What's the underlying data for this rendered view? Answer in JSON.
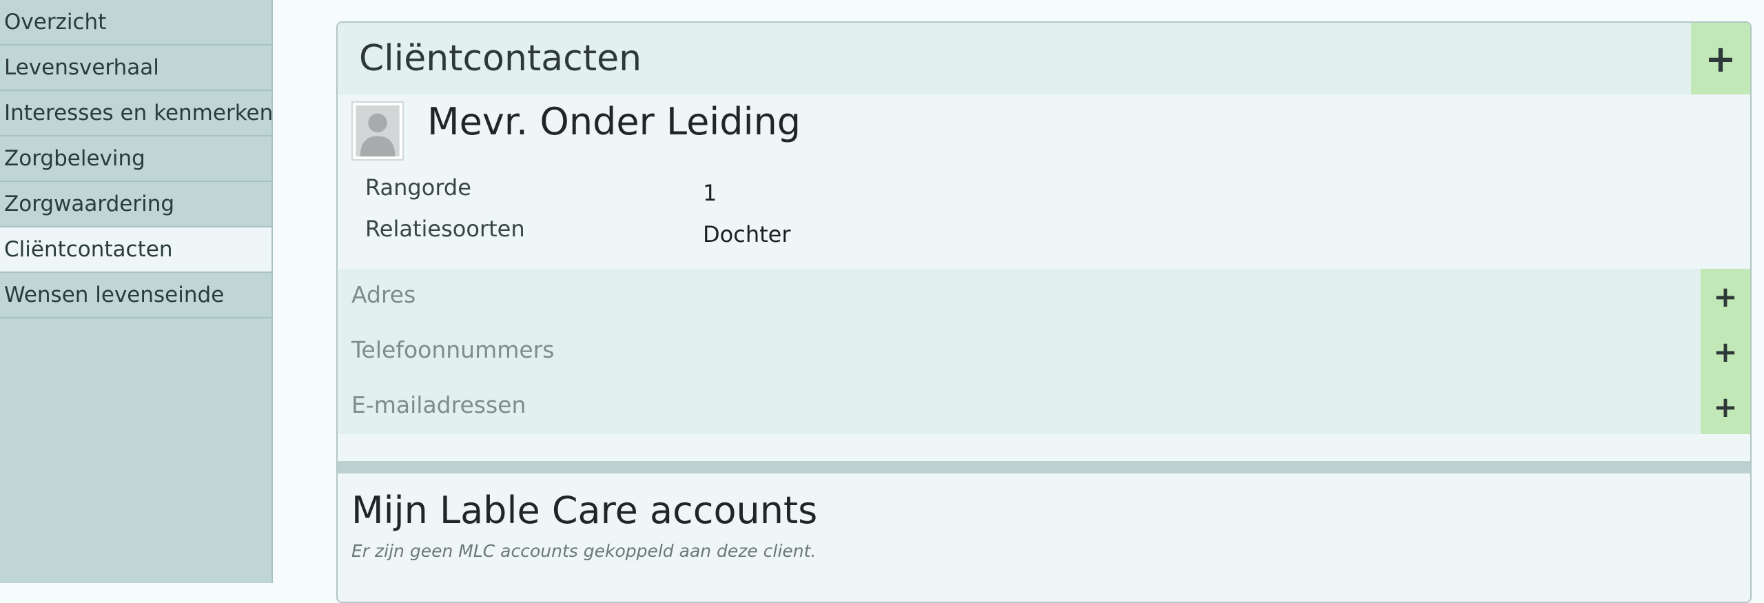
{
  "sidebar": {
    "items": [
      {
        "label": "Overzicht"
      },
      {
        "label": "Levensverhaal"
      },
      {
        "label": "Interesses en kenmerken"
      },
      {
        "label": "Zorgbeleving"
      },
      {
        "label": "Zorgwaardering"
      },
      {
        "label": "Cliëntcontacten",
        "active": true
      },
      {
        "label": "Wensen levenseinde"
      }
    ]
  },
  "panel": {
    "title": "Cliëntcontacten",
    "add_icon": "plus-icon",
    "contact": {
      "name": "Mevr. Onder Leiding",
      "avatar_icon": "user-silhouette-icon",
      "fields": [
        {
          "label": "Rangorde",
          "value": "1"
        },
        {
          "label": "Relatiesoorten",
          "value": "Dochter"
        }
      ]
    },
    "sub_sections": [
      {
        "label": "Adres"
      },
      {
        "label": "Telefoonnummers"
      },
      {
        "label": "E-mailadressen"
      }
    ]
  },
  "mlc": {
    "title": "Mijn Lable Care accounts",
    "note": "Er zijn geen MLC accounts gekoppeld aan deze client."
  },
  "colors": {
    "sidebar_bg": "#bfd6d5",
    "active_item_bg": "#eef6f7",
    "header_bg": "#e2f0f0",
    "add_button_bg": "#c2e8b7"
  }
}
